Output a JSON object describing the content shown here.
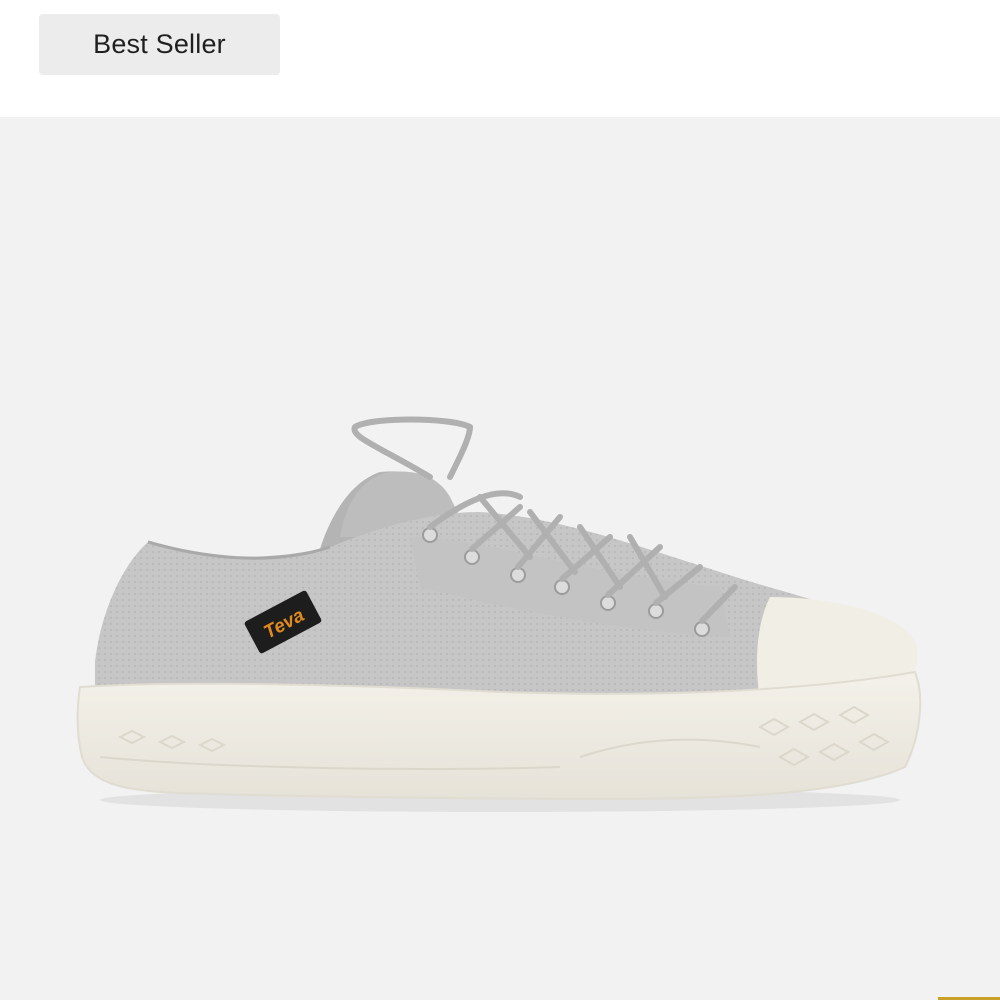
{
  "badge": {
    "label": "Best Seller"
  },
  "product": {
    "logo_text": "Teva",
    "colors": {
      "upper": "#c9c9c9",
      "midsole": "#f1eee6",
      "logo_bg": "#1d1d1d",
      "logo_text": "#e08a1e",
      "background": "#f2f2f2",
      "accent_corner": "#c8a02a"
    }
  }
}
